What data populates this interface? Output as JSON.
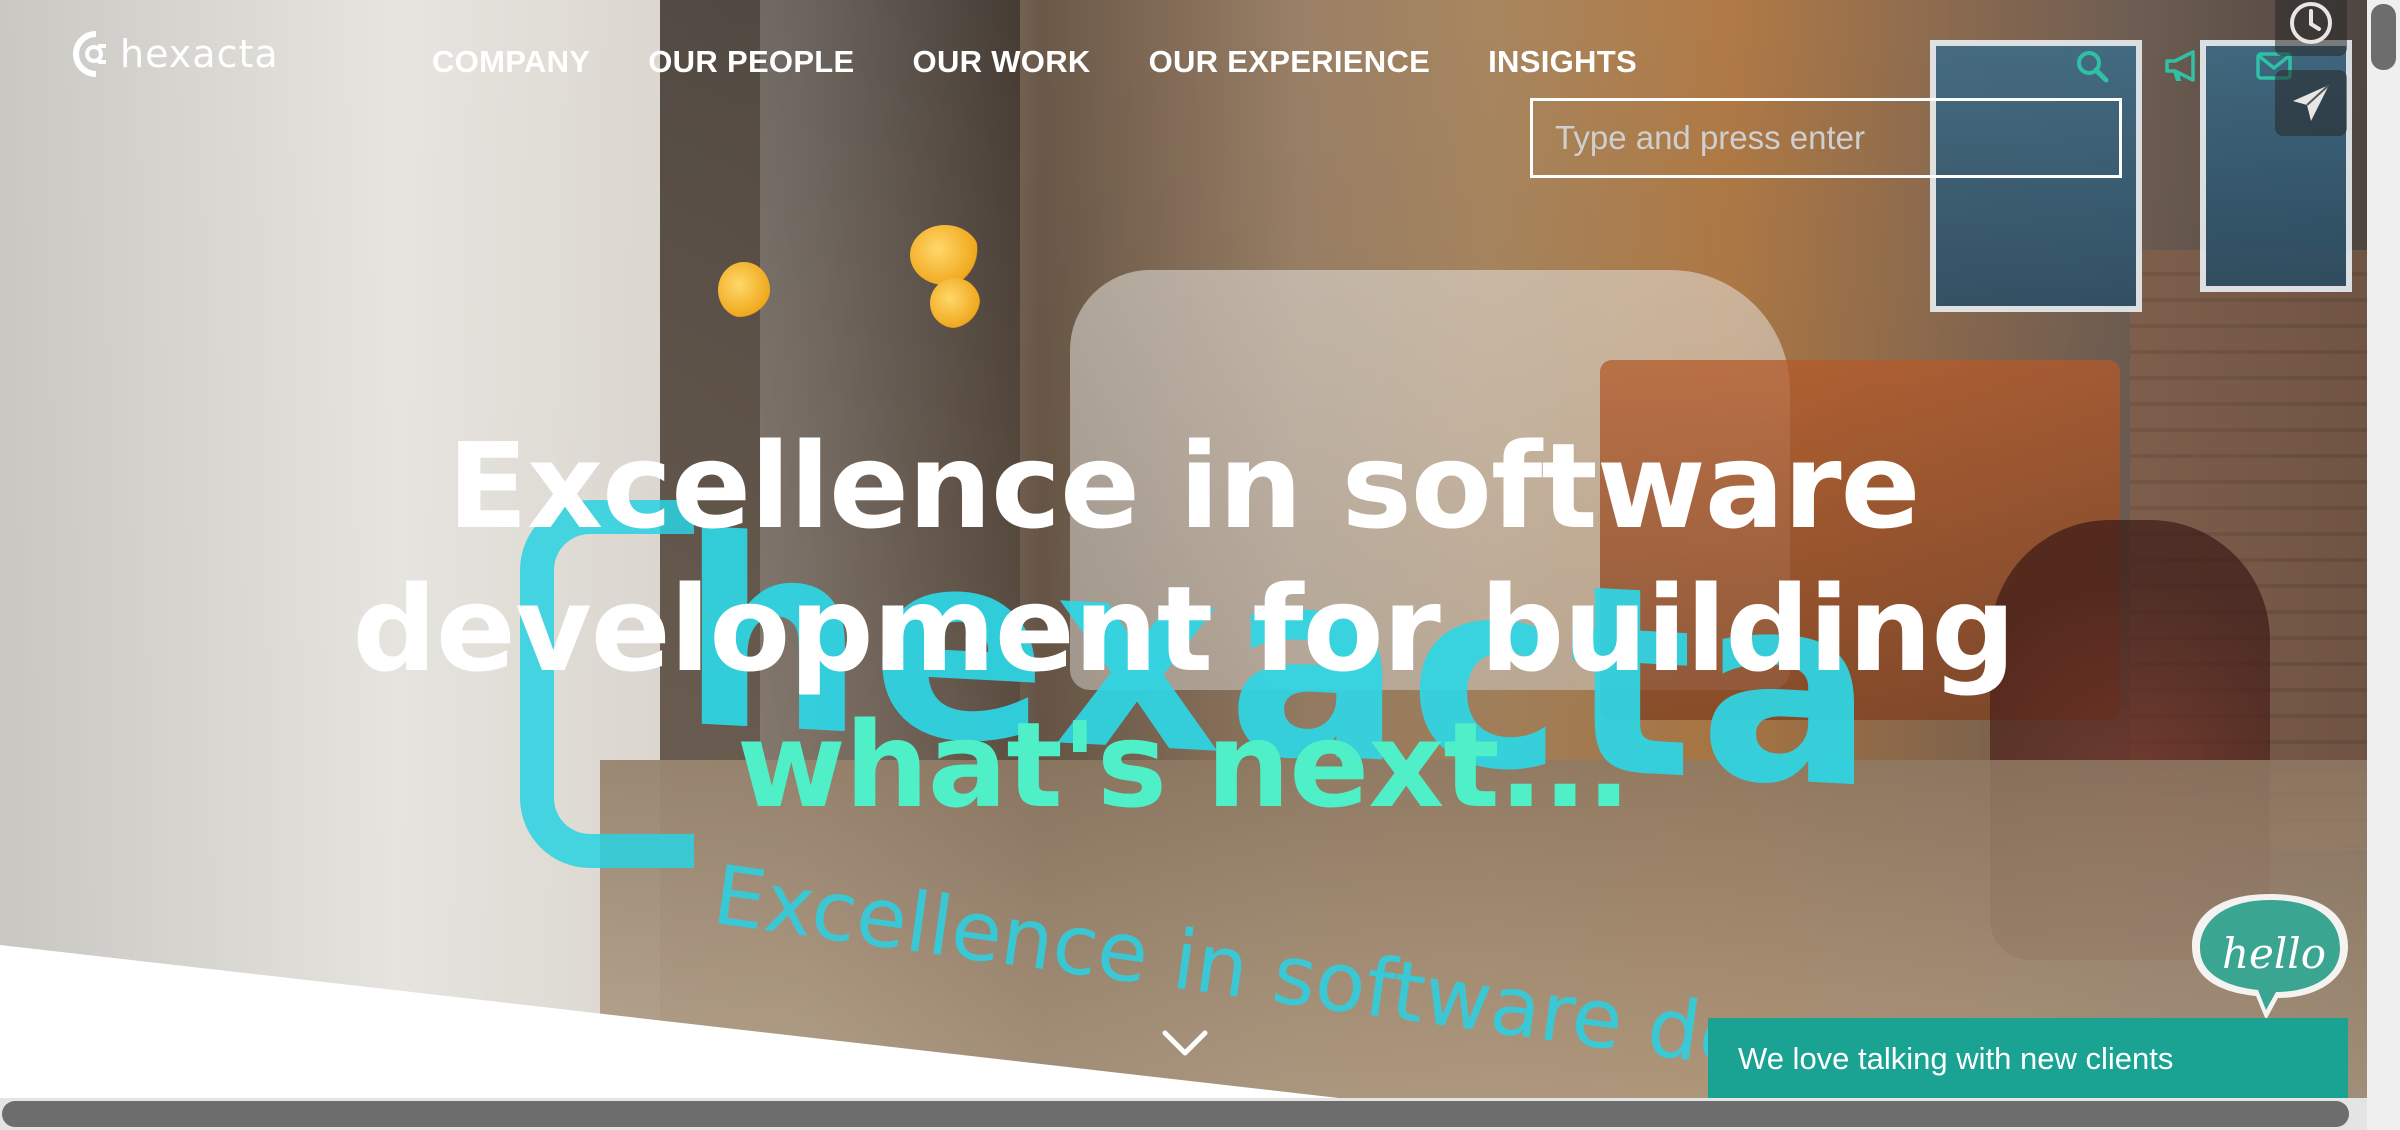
{
  "brand": {
    "logo_text": "hexacta"
  },
  "nav": {
    "items": [
      "COMPANY",
      "OUR PEOPLE",
      "OUR WORK",
      "OUR EXPERIENCE",
      "INSIGHTS"
    ]
  },
  "search": {
    "placeholder": "Type and press enter",
    "value": ""
  },
  "header_icons": [
    "search-icon",
    "megaphone-icon",
    "envelope-icon"
  ],
  "side_buttons": [
    "clock-icon",
    "paper-plane-icon"
  ],
  "hero": {
    "title_line1": "Excellence in software",
    "title_line2": "development for building",
    "subtitle": "what's next...",
    "decal_logo": "hexacta",
    "decal_tagline": "Excellence in software develop"
  },
  "chat": {
    "bubble_text": "hello",
    "bar_text": "We love talking with new clients"
  },
  "colors": {
    "accent": "#1aa392",
    "subtitle": "#4ff0c8",
    "decal": "#2ed7e6",
    "icon": "#2fc1a6"
  }
}
